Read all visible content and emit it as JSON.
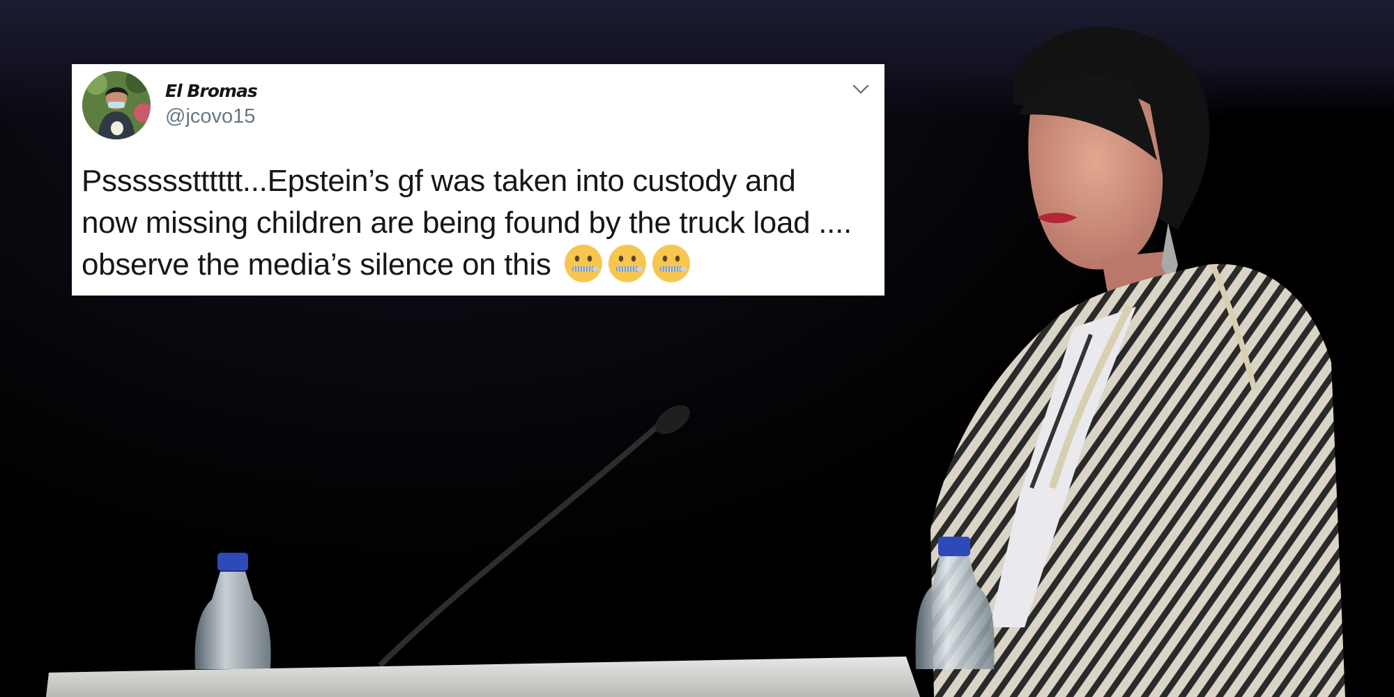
{
  "tweet": {
    "author": {
      "display_name": "El Bromas",
      "handle": "@jcovo15"
    },
    "text_lines": [
      "Psssssstttttt...Epstein’s gf was taken into custody and",
      "now missing children are being found by the truck load ....",
      "observe the media’s silence on this"
    ],
    "emoji": [
      "zipper-mouth-face",
      "zipper-mouth-face",
      "zipper-mouth-face"
    ],
    "menu_icon": "chevron-down-icon"
  },
  "photo": {
    "description_icons": [
      "speaker-figure",
      "microphone",
      "water-bottle",
      "water-bottle",
      "podium"
    ]
  },
  "colors": {
    "card_background": "#ffffff",
    "text_primary": "#14171a",
    "text_secondary": "#657786",
    "emoji_face": "#f7c64f"
  }
}
